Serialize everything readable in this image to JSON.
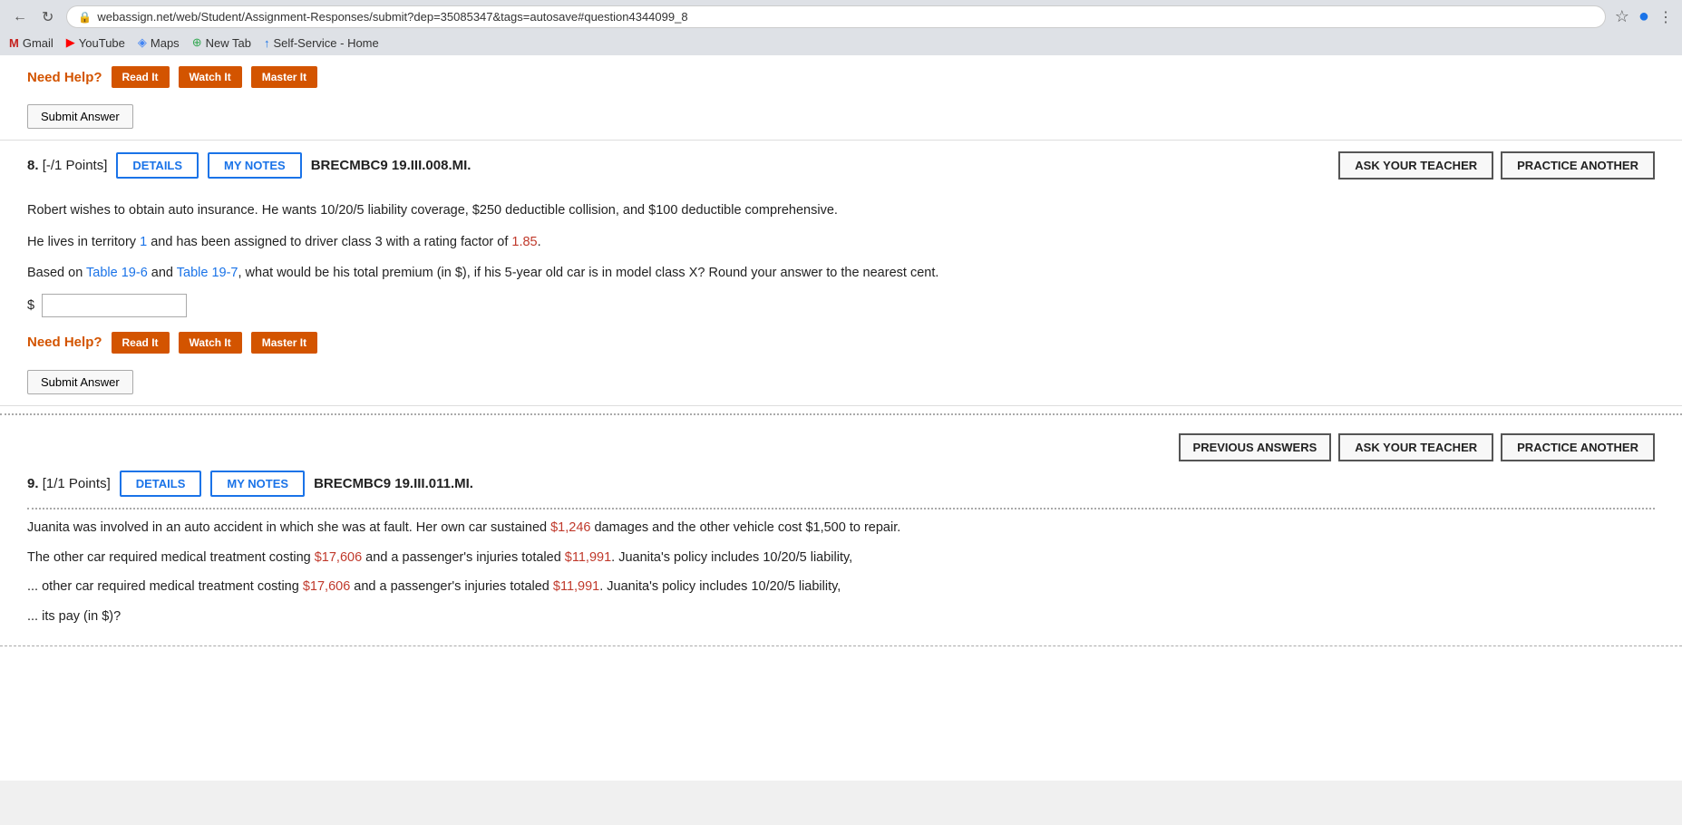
{
  "browser": {
    "back_icon": "←",
    "refresh_icon": "↻",
    "url": "webassign.net/web/Student/Assignment-Responses/submit?dep=35085347&tags=autosave#question4344099_8",
    "star_icon": "☆",
    "bookmarks": [
      {
        "label": "Gmail",
        "icon": "M",
        "icon_class": "bookmark-icon-gmail"
      },
      {
        "label": "YouTube",
        "icon": "▶",
        "icon_class": "bookmark-icon-youtube"
      },
      {
        "label": "Maps",
        "icon": "◈",
        "icon_class": "bookmark-icon-maps"
      },
      {
        "label": "New Tab",
        "icon": "⊕",
        "icon_class": "bookmark-icon-newtab"
      },
      {
        "label": "Self-Service - Home",
        "icon": "↑",
        "icon_class": "bookmark-icon-self"
      }
    ]
  },
  "section_top": {
    "need_help_label": "Need Help?",
    "read_it_btn": "Read It",
    "watch_it_btn": "Watch It",
    "master_it_btn": "Master It",
    "submit_answer_btn": "Submit Answer"
  },
  "question_8": {
    "points_label": "[-/1 Points]",
    "details_btn": "DETAILS",
    "my_notes_btn": "MY NOTES",
    "code": "BRECMBC9 19.III.008.MI.",
    "ask_teacher_btn": "ASK YOUR TEACHER",
    "practice_another_btn": "PRACTICE ANOTHER",
    "body_line1": "Robert wishes to obtain auto insurance. He wants 10/20/5 liability coverage, $250 deductible collision, and $100 deductible comprehensive.",
    "body_line2_part1": "He lives in territory ",
    "body_line2_territory": "1",
    "body_line2_part2": " and has been assigned to driver class 3 with a rating factor of ",
    "body_line2_factor": "1.85",
    "body_line2_end": ".",
    "body_line3_part1": "Based on ",
    "body_line3_table1": "Table 19-6",
    "body_line3_part2": " and ",
    "body_line3_table2": "Table 19-7",
    "body_line3_part3": ", what would be his total premium (in $), if his 5-year old car is in model class X? Round your answer to the nearest cent.",
    "answer_prefix": "$",
    "answer_placeholder": "",
    "need_help_label": "Need Help?",
    "read_it_btn": "Read It",
    "watch_it_btn": "Watch It",
    "master_it_btn": "Master It",
    "submit_answer_btn": "Submit Answer"
  },
  "question_9": {
    "prev_answers_btn": "PREVIOUS ANSWERS",
    "ask_teacher_btn": "ASK YOUR TEACHER",
    "practice_another_btn": "PRACTICE ANOTHER",
    "points_label": "[1/1 Points]",
    "details_btn": "DETAILS",
    "my_notes_btn": "MY NOTES",
    "code": "BRECMBC9 19.III.011.MI.",
    "body_line1": "Juanita was involved in an auto accident in which she was at fault. Her own car sustained $1,246 damages and the other vehicle cost $1,500 to repair.",
    "body_line2_part1": "The other car required medical treatment costing $17,606 and a passenger's injuries totaled $11,991. Juanita's policy includes 10/20/5 liability,",
    "body_line3": "... other car required medical treatment costing ",
    "damage1": "$1,246",
    "damage2": "$17,606",
    "damage3": "$11,991",
    "body_suffix": "its pay (in $)?"
  }
}
